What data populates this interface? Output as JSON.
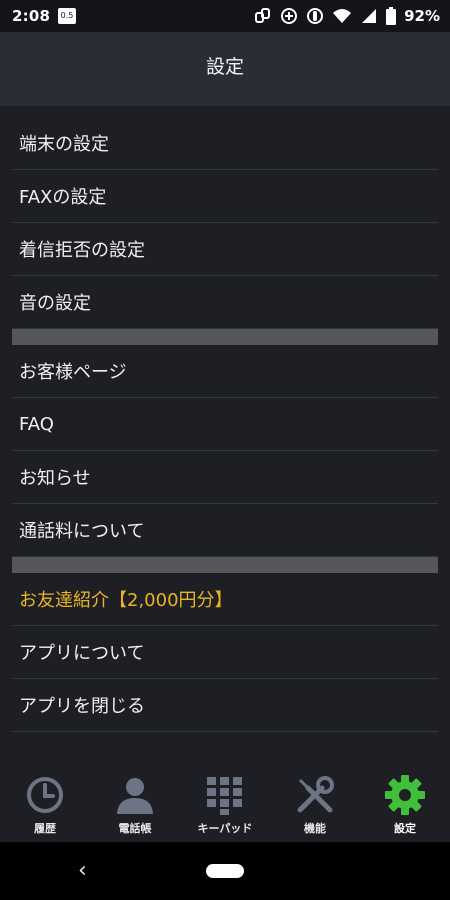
{
  "status_bar": {
    "time": "2:08",
    "sim_label": "0.5",
    "battery": "92%"
  },
  "header": {
    "title": "設定"
  },
  "menu": {
    "group1": [
      "端末の設定",
      "FAXの設定",
      "着信拒否の設定",
      "音の設定"
    ],
    "group2": [
      "お客様ページ",
      "FAQ",
      "お知らせ",
      "通話料について"
    ],
    "group3": [
      "お友達紹介【2,000円分】",
      "アプリについて",
      "アプリを閉じる"
    ]
  },
  "tabs": [
    {
      "label": "履歴",
      "icon": "clock-icon"
    },
    {
      "label": "電話帳",
      "icon": "person-icon"
    },
    {
      "label": "キーパッド",
      "icon": "keypad-icon"
    },
    {
      "label": "機能",
      "icon": "tools-icon"
    },
    {
      "label": "設定",
      "icon": "gear-icon",
      "active": true
    }
  ],
  "colors": {
    "background": "#1e1f24",
    "header": "#2a2d36",
    "highlight": "#e8b422",
    "inactive_icon": "#6d7486",
    "active_icon": "#3fbf3a"
  }
}
